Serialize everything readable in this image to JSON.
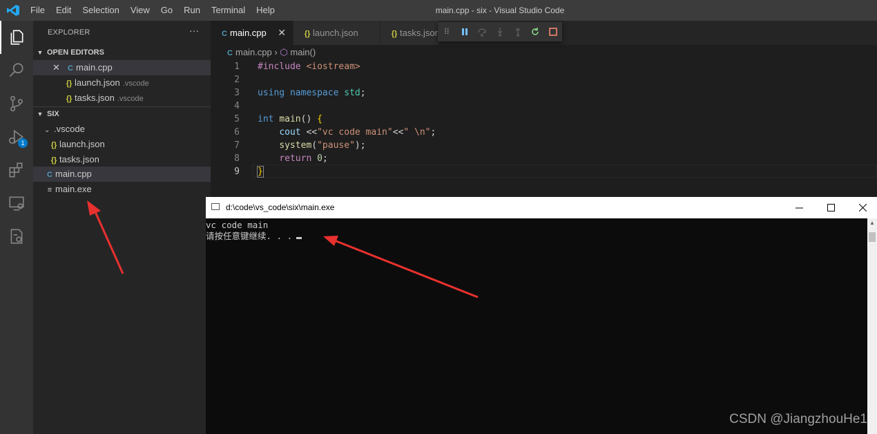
{
  "app": {
    "window_title": "main.cpp - six - Visual Studio Code",
    "menu": [
      "File",
      "Edit",
      "Selection",
      "View",
      "Go",
      "Run",
      "Terminal",
      "Help"
    ]
  },
  "activity_bar": {
    "items": [
      "explorer-icon",
      "search-icon",
      "source-control-icon",
      "run-debug-icon",
      "extensions-icon",
      "remote-explorer-icon",
      "cmake-icon"
    ],
    "debug_badge": "1"
  },
  "sidebar": {
    "title": "EXPLORER",
    "more": "···",
    "open_editors": {
      "header": "OPEN EDITORS",
      "items": [
        {
          "name": "main.cpp",
          "path": ""
        },
        {
          "name": "launch.json",
          "path": ".vscode"
        },
        {
          "name": "tasks.json",
          "path": ".vscode"
        }
      ]
    },
    "folder": {
      "header": "SIX",
      "subfolder": ".vscode",
      "sub_items": [
        "launch.json",
        "tasks.json"
      ],
      "items": [
        "main.cpp",
        "main.exe"
      ]
    }
  },
  "tabs": [
    {
      "label": "main.cpp",
      "active": true,
      "close": "✕"
    },
    {
      "label": "launch.json",
      "active": false
    },
    {
      "label": "tasks.json",
      "active": false
    }
  ],
  "breadcrumb": {
    "file": "main.cpp",
    "symbol": "main()"
  },
  "editor": {
    "line_numbers": [
      "1",
      "2",
      "3",
      "4",
      "5",
      "6",
      "7",
      "8",
      "9"
    ]
  },
  "console": {
    "title": "d:\\code\\vs_code\\six\\main.exe",
    "output_line1": "vc code main",
    "output_line2": "请按任意键继续. . ."
  },
  "watermark": "CSDN @JiangzhouHe1",
  "colors": {
    "accent": "#007acc",
    "annotation_arrow": "#e8312f"
  }
}
